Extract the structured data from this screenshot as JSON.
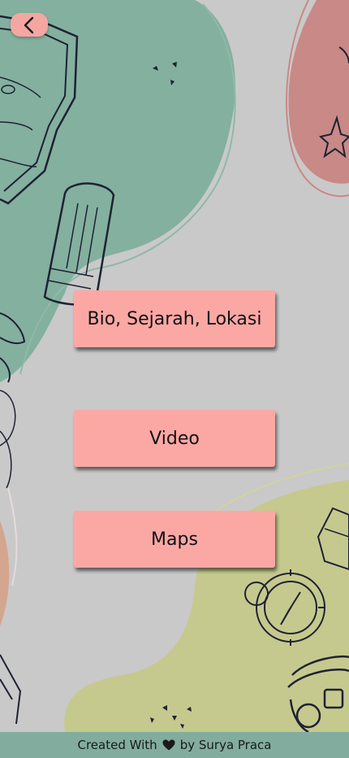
{
  "header": {
    "back_icon": "chevron-left-icon"
  },
  "menu": {
    "bio_label": "Bio, Sejarah, Lokasi",
    "video_label": "Video",
    "maps_label": "Maps"
  },
  "footer": {
    "prefix": "Created With",
    "heart_icon": "heart-icon",
    "suffix": "by Surya Praca"
  },
  "colors": {
    "background": "#c9c9c9",
    "green_blob": "#84b09f",
    "red_blob": "#c98986",
    "olive_blob": "#c6c98d",
    "button": "#fba8a5",
    "footer": "#82ad9e"
  }
}
